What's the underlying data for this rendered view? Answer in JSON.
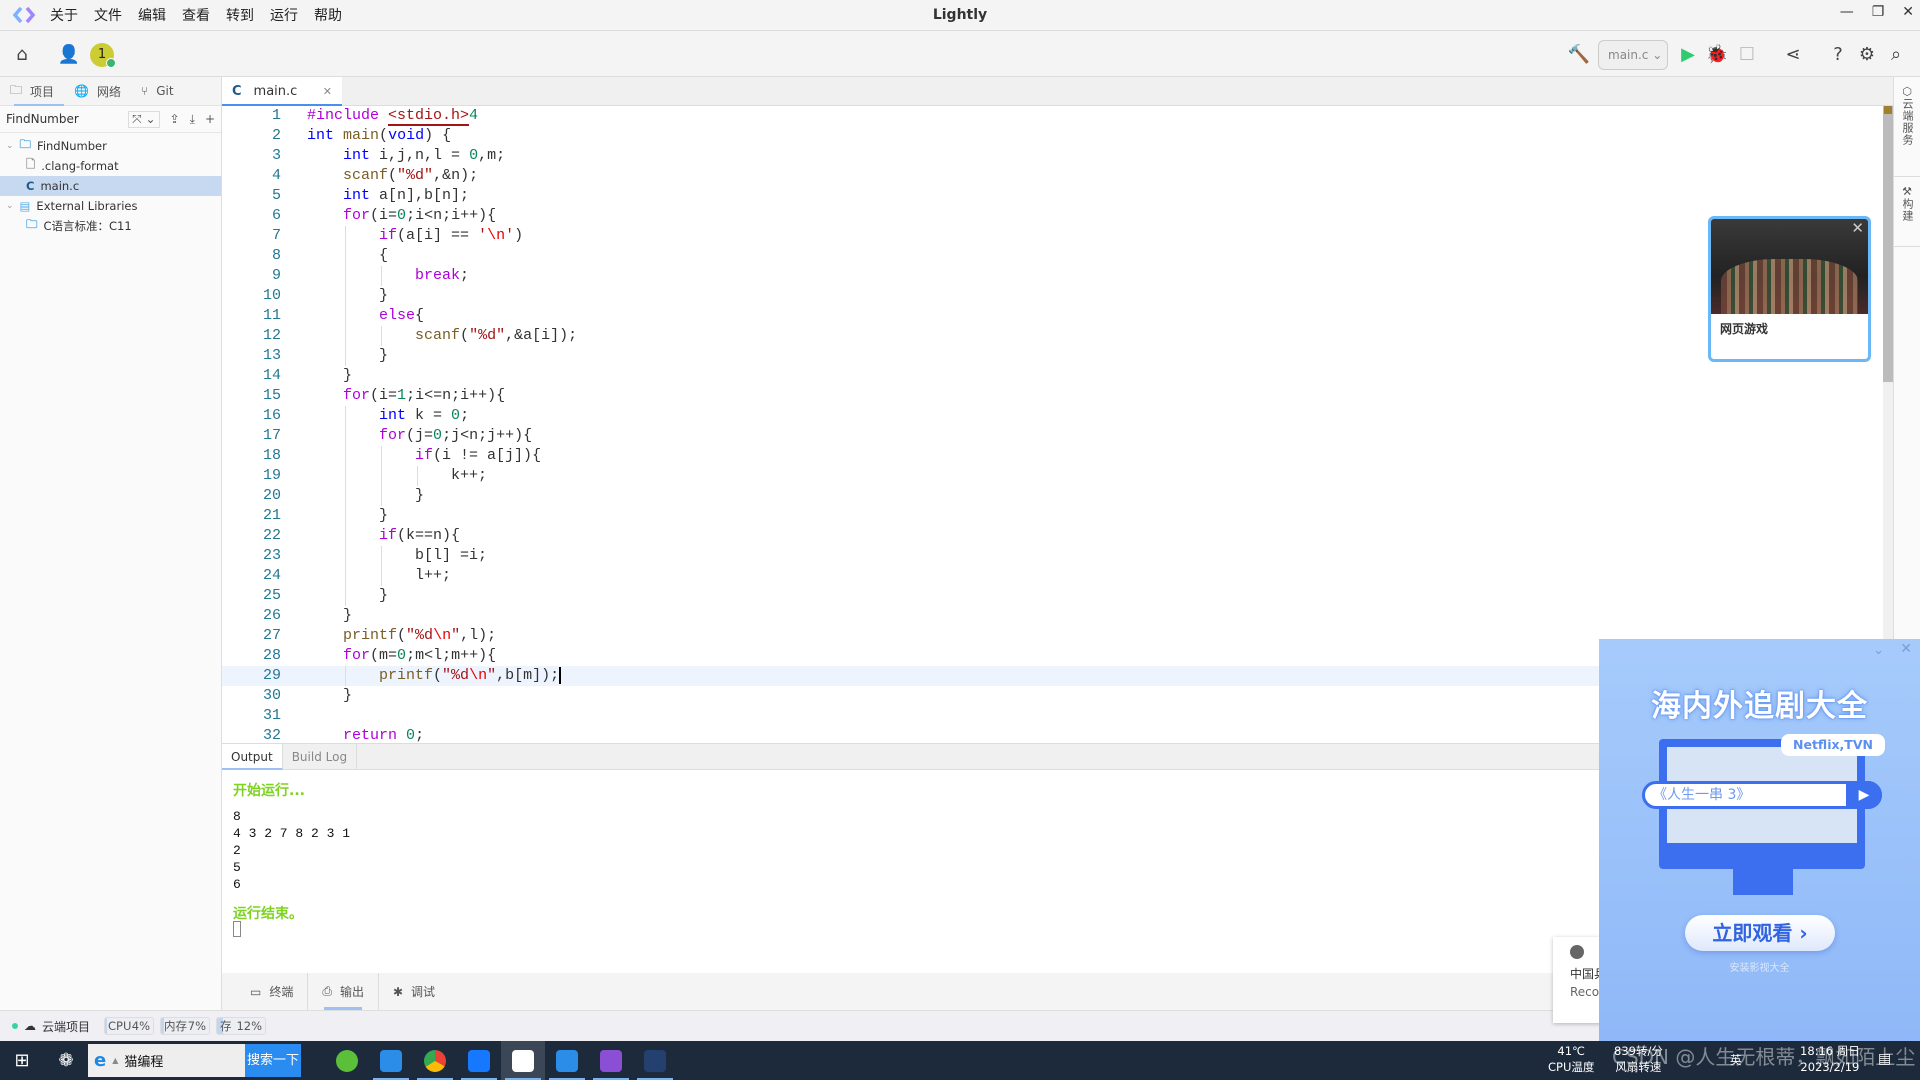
{
  "app": {
    "title": "Lightly",
    "menu": [
      "关于",
      "文件",
      "编辑",
      "查看",
      "转到",
      "运行",
      "帮助"
    ]
  },
  "toolbar": {
    "avatar_label": "1",
    "run_target": "main.c",
    "accent": "#2ecc71"
  },
  "sidebar": {
    "tabs": [
      "项目",
      "网络",
      "Git"
    ],
    "project_name": "FindNumber",
    "tree": [
      {
        "label": "FindNumber",
        "type": "folder",
        "level": 0
      },
      {
        "label": ".clang-format",
        "type": "file",
        "level": 1
      },
      {
        "label": "main.c",
        "type": "c-file",
        "level": 1,
        "selected": true
      },
      {
        "label": "External Libraries",
        "type": "library",
        "level": 0
      },
      {
        "label": "C语言标准：C11",
        "type": "folder",
        "level": 1
      }
    ]
  },
  "editor": {
    "tab_label": "main.c",
    "current_line": 29,
    "lines": [
      "#include <stdio.h>4",
      "int main(void) {",
      "    int i,j,n,l = 0,m;",
      "    scanf(\"%d\",&n);",
      "    int a[n],b[n];",
      "    for(i=0;i<n;i++){",
      "        if(a[i] == '\\n')",
      "        {",
      "            break;",
      "        }",
      "        else{",
      "            scanf(\"%d\",&a[i]);",
      "        }",
      "    }",
      "    for(i=1;i<=n;i++){",
      "        int k = 0;",
      "        for(j=0;j<n;j++){",
      "            if(i != a[j]){",
      "                k++;",
      "            }",
      "        }",
      "        if(k==n){",
      "            b[l] =i;",
      "            l++;",
      "        }",
      "    }",
      "    printf(\"%d\\n\",l);",
      "    for(m=0;m<l;m++){",
      "        printf(\"%d\\n\",b[m]);",
      "    }",
      "",
      "    return 0;"
    ]
  },
  "output": {
    "tabs": [
      "Output",
      "Build Log"
    ],
    "start_text": "开始运行...",
    "lines": [
      "8",
      "4 3 2 7 8 2 3 1",
      "2",
      "5",
      "6"
    ],
    "end_text": "运行结束。"
  },
  "bottom_tabs": [
    "终端",
    "输出",
    "调试"
  ],
  "right_panel": [
    "云端服务",
    "构建"
  ],
  "statusbar": {
    "cloud_label": "云端项目",
    "meters": [
      {
        "label": "CPU",
        "value": "4%",
        "percent": 4
      },
      {
        "label": "内存",
        "value": "7%",
        "percent": 7
      },
      {
        "label": "存储",
        "value": "12%",
        "percent": 12
      }
    ]
  },
  "game_popup": {
    "label": "网页游戏"
  },
  "ad": {
    "title": "海内外追剧大全",
    "bubble": "Netflix,TVN",
    "search_text": "《人生一串 3》",
    "cta": "立即观看 ›",
    "sub": "安装影视大全"
  },
  "notification": {
    "line1": "中国乒",
    "line2": "Reco"
  },
  "taskbar": {
    "search_text": "猫编程",
    "search_button": "搜索一下",
    "cpu_temp": "41℃",
    "cpu_temp_label": "CPU温度",
    "fan_speed": "839转/分",
    "fan_label": "风扇转速",
    "time": "18:16 周日",
    "date": "2023/2/19",
    "ime": "英",
    "watermark": "CSDN @人生无根蒂，飘如陌上尘"
  }
}
